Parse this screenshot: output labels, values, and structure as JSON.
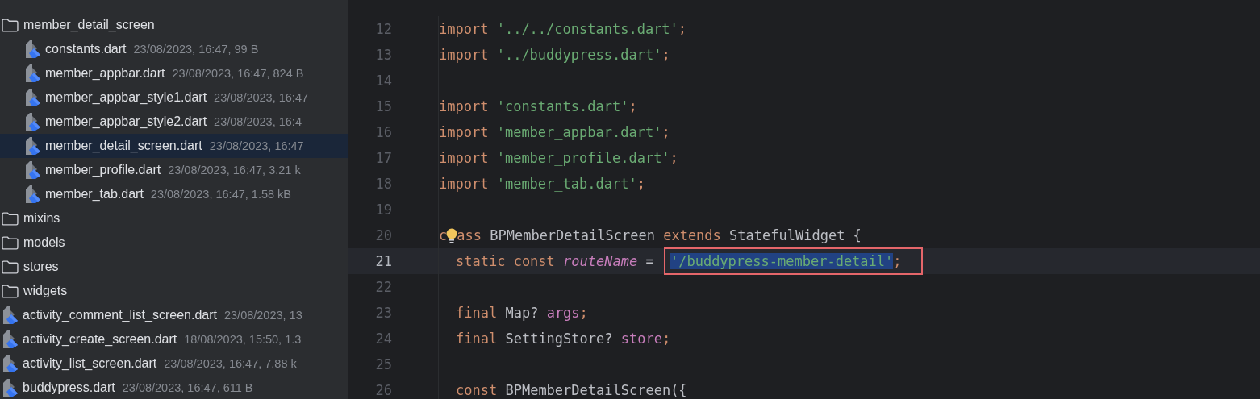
{
  "project_tree": {
    "items": [
      {
        "kind": "folder",
        "name": "member_detail_screen",
        "children": [
          {
            "kind": "file",
            "name": "constants.dart",
            "meta": "23/08/2023, 16:47, 99 B",
            "selected": false
          },
          {
            "kind": "file",
            "name": "member_appbar.dart",
            "meta": "23/08/2023, 16:47, 824 B",
            "selected": false
          },
          {
            "kind": "file",
            "name": "member_appbar_style1.dart",
            "meta": "23/08/2023, 16:47",
            "selected": false
          },
          {
            "kind": "file",
            "name": "member_appbar_style2.dart",
            "meta": "23/08/2023, 16:4",
            "selected": false
          },
          {
            "kind": "file",
            "name": "member_detail_screen.dart",
            "meta": "23/08/2023, 16:47",
            "selected": true
          },
          {
            "kind": "file",
            "name": "member_profile.dart",
            "meta": "23/08/2023, 16:47, 3.21 k",
            "selected": false
          },
          {
            "kind": "file",
            "name": "member_tab.dart",
            "meta": "23/08/2023, 16:47, 1.58 kB",
            "selected": false
          }
        ]
      },
      {
        "kind": "folder",
        "name": "mixins"
      },
      {
        "kind": "folder",
        "name": "models"
      },
      {
        "kind": "folder",
        "name": "stores"
      },
      {
        "kind": "folder",
        "name": "widgets"
      },
      {
        "kind": "file",
        "name": "activity_comment_list_screen.dart",
        "meta": "23/08/2023, 13",
        "selected": false
      },
      {
        "kind": "file",
        "name": "activity_create_screen.dart",
        "meta": "18/08/2023, 15:50, 1.3",
        "selected": false
      },
      {
        "kind": "file",
        "name": "activity_list_screen.dart",
        "meta": "23/08/2023, 16:47, 7.88 k",
        "selected": false
      },
      {
        "kind": "file",
        "name": "buddypress.dart",
        "meta": "23/08/2023, 16:47, 611 B",
        "selected": false
      }
    ]
  },
  "editor": {
    "lines": [
      {
        "number": "12",
        "current": false,
        "tokens": [
          {
            "kind": "keyword",
            "text": "import"
          },
          {
            "kind": "string",
            "text": "'../../constants.dart'"
          },
          {
            "kind": "punct",
            "text": ";"
          }
        ]
      },
      {
        "number": "13",
        "current": false,
        "tokens": [
          {
            "kind": "keyword",
            "text": "import"
          },
          {
            "kind": "string",
            "text": "'../buddypress.dart'"
          },
          {
            "kind": "punct",
            "text": ";"
          }
        ]
      },
      {
        "number": "14",
        "current": false
      },
      {
        "number": "15",
        "current": false,
        "tokens": [
          {
            "kind": "keyword",
            "text": "import"
          },
          {
            "kind": "string",
            "text": "'constants.dart'"
          },
          {
            "kind": "punct",
            "text": ";"
          }
        ]
      },
      {
        "number": "16",
        "current": false,
        "tokens": [
          {
            "kind": "keyword",
            "text": "import"
          },
          {
            "kind": "string",
            "text": "'member_appbar.dart'"
          },
          {
            "kind": "punct",
            "text": ";"
          }
        ]
      },
      {
        "number": "17",
        "current": false,
        "tokens": [
          {
            "kind": "keyword",
            "text": "import"
          },
          {
            "kind": "string",
            "text": "'member_profile.dart'"
          },
          {
            "kind": "punct",
            "text": ";"
          }
        ]
      },
      {
        "number": "18",
        "current": false,
        "tokens": [
          {
            "kind": "keyword",
            "text": "import"
          },
          {
            "kind": "string",
            "text": "'member_tab.dart'"
          },
          {
            "kind": "punct",
            "text": ";"
          }
        ]
      },
      {
        "number": "19",
        "current": false
      },
      {
        "number": "20",
        "current": false,
        "tokens": [
          {
            "kind": "keyword",
            "text": "c"
          },
          {
            "kind": "bulb"
          },
          {
            "kind": "keyword",
            "text": "ass"
          },
          {
            "kind": "plain",
            "text": "BPMemberDetailScreen"
          },
          {
            "kind": "keyword",
            "text": "extends"
          },
          {
            "kind": "plain",
            "text": "StatefulWidget {"
          }
        ]
      },
      {
        "number": "21",
        "current": true,
        "indent": true,
        "tokens": [
          {
            "kind": "keyword",
            "text": "static const"
          },
          {
            "kind": "field",
            "text": "routeName"
          },
          {
            "kind": "plain",
            "text": "="
          },
          {
            "kind": "string",
            "text": "'/buddypress-member-detail'",
            "selected": true,
            "boxed": true
          },
          {
            "kind": "punct",
            "text": ";",
            "selected": false,
            "boxed": true
          }
        ]
      },
      {
        "number": "22",
        "current": false
      },
      {
        "number": "23",
        "current": false,
        "indent": true,
        "tokens": [
          {
            "kind": "keyword",
            "text": "final"
          },
          {
            "kind": "plain",
            "text": "Map?"
          },
          {
            "kind": "member",
            "text": "args"
          },
          {
            "kind": "punct",
            "text": ";"
          }
        ]
      },
      {
        "number": "24",
        "current": false,
        "indent": true,
        "tokens": [
          {
            "kind": "keyword",
            "text": "final"
          },
          {
            "kind": "plain",
            "text": "SettingStore?"
          },
          {
            "kind": "member",
            "text": "store"
          },
          {
            "kind": "punct",
            "text": ";"
          }
        ]
      },
      {
        "number": "25",
        "current": false
      },
      {
        "number": "26",
        "current": false,
        "indent": true,
        "tokens": [
          {
            "kind": "keyword",
            "text": "const"
          },
          {
            "kind": "plain",
            "text": "BPMemberDetailScreen({"
          }
        ]
      }
    ]
  }
}
